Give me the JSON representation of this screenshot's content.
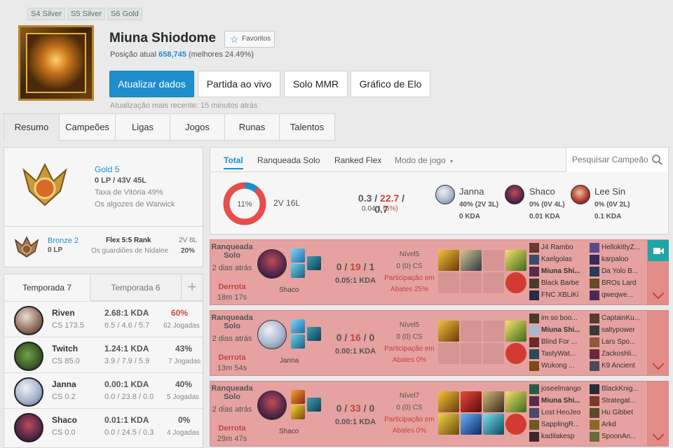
{
  "seasons": [
    "S4 Silver",
    "S5 Silver",
    "S6 Gold"
  ],
  "summoner": {
    "name": "Miuna Shiodome",
    "favorite_label": "Favoritos",
    "rank_prefix": "Posição atual",
    "rank_value": "658,745",
    "rank_suffix": "(melhores 24.49%)",
    "updated": "Atualização mais recente: 15 minutos atrás"
  },
  "buttons": {
    "refresh": "Atualizar dados",
    "live": "Partida ao vivo",
    "mmr": "Solo MMR",
    "elo": "Gráfico de Elo"
  },
  "tabs": [
    "Resumo",
    "Campeões",
    "Ligas",
    "Jogos",
    "Runas",
    "Talentos"
  ],
  "solo_rank": {
    "tier": "Gold 5",
    "lp_line": "0 LP / 43V 45L",
    "winrate": "Taxa de Vitória 49%",
    "league": "Os algozes de Warwick"
  },
  "flex_rank": {
    "tier": "Bronze 2",
    "lp": "0 LP",
    "queue": "Flex 5:5 Rank",
    "league": "Os guardiões de Nidalee",
    "record": "2V 8L",
    "winrate": "20%"
  },
  "season_tabs": [
    "Temporada 7",
    "Temporada 6"
  ],
  "champions": [
    {
      "name": "Riven",
      "cs": "CS 173.5",
      "kda": "2.68:1 KDA",
      "detail": "6.5 / 4.6 / 5.7",
      "winrate": "60%",
      "games": "62 Jogadas",
      "color": "#c94a3a"
    },
    {
      "name": "Twitch",
      "cs": "CS 85.0",
      "kda": "1.24:1 KDA",
      "detail": "3.9 / 7.9 / 5.9",
      "winrate": "43%",
      "games": "7 Jogadas",
      "color": "#555"
    },
    {
      "name": "Janna",
      "cs": "CS 0.2",
      "kda": "0.00:1 KDA",
      "detail": "0.0 / 23.8 / 0.0",
      "winrate": "40%",
      "games": "5 Jogadas",
      "color": "#555"
    },
    {
      "name": "Shaco",
      "cs": "CS 0.0",
      "kda": "0.01:1 KDA",
      "detail": "0.0 / 24.5 / 0.3",
      "winrate": "0%",
      "games": "4 Jogadas",
      "color": "#555"
    }
  ],
  "filters": {
    "tabs": [
      "Total",
      "Ranqueada Solo",
      "Ranked Flex",
      "Modo de jogo"
    ],
    "search_placeholder": "Pesquisar Campeão"
  },
  "summary": {
    "winrate_pct": 11,
    "winrate_label": "11%",
    "record": "2V 16L",
    "k": "0.3",
    "d": "22.7",
    "a": "0.7",
    "ratio": "0.04:1",
    "kp": "(5%)",
    "top": [
      {
        "name": "Janna",
        "line": "40% (2V 3L)",
        "kda": "0 KDA"
      },
      {
        "name": "Shaco",
        "line": "0% (0V 4L)",
        "kda": "0.01 KDA"
      },
      {
        "name": "Lee Sin",
        "line": "0% (0V 2L)",
        "kda": "0.1 KDA"
      }
    ]
  },
  "games": [
    {
      "type": "Ranqueada Solo",
      "ago": "2 dias atrás",
      "result": "Derrota",
      "duration": "18m 17s",
      "champion": "Shaco",
      "k": "0",
      "d": "19",
      "a": "1",
      "kda": "0.05:1 KDA",
      "level": "Nível5",
      "cs": "0 (0) CS",
      "kp_label": "Participação em",
      "kp": "Abates 25%",
      "team1": [
        "J4 Rambo",
        "Kaelgolas",
        "Miuna Shi...",
        "Black Barbe",
        "FNC XBLiKi"
      ],
      "team2": [
        "HellokittyZ...",
        "karpaloo",
        "Da Yolo B...",
        "BROs Lard",
        "qweqwe..."
      ]
    },
    {
      "type": "Ranqueada Solo",
      "ago": "2 dias atrás",
      "result": "Derrota",
      "duration": "13m 54s",
      "champion": "Janna",
      "k": "0",
      "d": "16",
      "a": "0",
      "kda": "0.00:1 KDA",
      "level": "Nível5",
      "cs": "0 (0) CS",
      "kp_label": "Participação em",
      "kp": "Abates 0%",
      "team1": [
        "im so boo...",
        "Miuna Shi...",
        "Blind For ...",
        "TastyWat...",
        "Wukong ..."
      ],
      "team2": [
        "CaptainKu...",
        "saltypower",
        "Lars Spo...",
        "Zackoshli...",
        "K9 Ancient"
      ]
    },
    {
      "type": "Ranqueada Solo",
      "ago": "2 dias atrás",
      "result": "Derrota",
      "duration": "29m 47s",
      "champion": "Shaco",
      "k": "0",
      "d": "33",
      "a": "0",
      "kda": "0.00:1 KDA",
      "level": "Nível7",
      "cs": "0 (0) CS",
      "kp_label": "Participação em",
      "kp": "Abates 0%",
      "team1": [
        "joseelmango",
        "Miuna Shi...",
        "Lost HeoJeo",
        "SapplingR...",
        "kadilakesp"
      ],
      "team2": [
        "BlackKnig...",
        "Strategat...",
        "Hu Gibbet",
        "Arkd",
        "SpoonAn..."
      ]
    }
  ],
  "colors": {
    "accent": "#1f8ecd",
    "loss_bg": "#e5a2a0",
    "loss_text": "#c6443e",
    "live": "#1ea6a6"
  }
}
